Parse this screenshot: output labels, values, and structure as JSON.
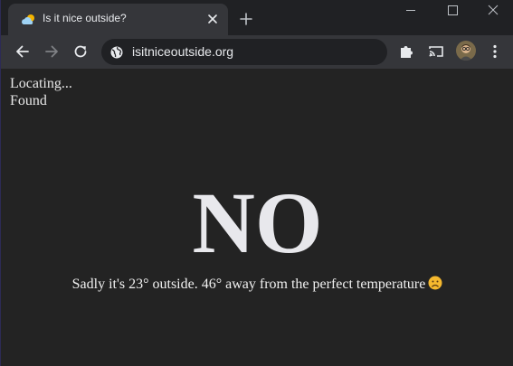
{
  "browser": {
    "tab": {
      "title": "Is it nice outside?",
      "favicon": "weather-sun-cloud-icon"
    },
    "address_bar": {
      "url": "isitniceoutside.org",
      "site_info_icon": "globe-icon"
    },
    "toolbar_icons": [
      "back-arrow-icon",
      "forward-arrow-icon",
      "reload-icon",
      "extensions-puzzle-icon",
      "cast-icon",
      "profile-avatar",
      "more-menu-icon"
    ],
    "window_controls": [
      "minimize-icon",
      "maximize-icon",
      "close-icon"
    ]
  },
  "page": {
    "status_lines": [
      "Locating...",
      "Found"
    ],
    "answer": "NO",
    "detail_text": "Sadly it's 23° outside. 46° away from the perfect temperature",
    "detail_emoji": "sad-face-emoji"
  },
  "colors": {
    "page_background": "#232323",
    "tabstrip_background": "#202124",
    "toolbar_background": "#35363a",
    "text": "#e8eaed",
    "emoji_face": "#f5b82e"
  }
}
